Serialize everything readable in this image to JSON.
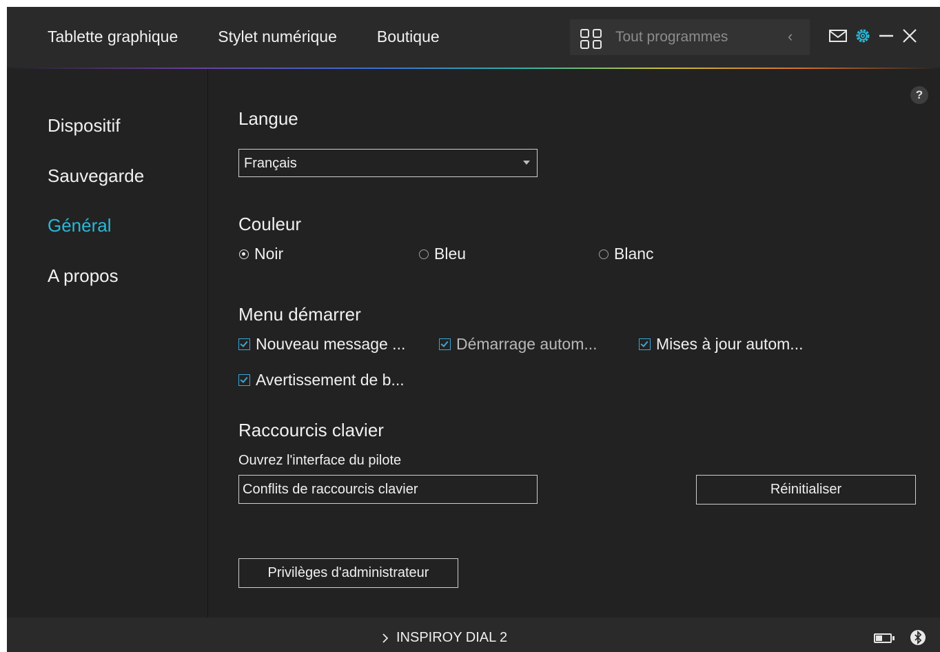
{
  "header": {
    "tabs": [
      {
        "label": "Tablette graphique"
      },
      {
        "label": "Stylet numérique"
      },
      {
        "label": "Boutique"
      }
    ],
    "search": {
      "placeholder": "Tout programmes",
      "grid_icon": "grid-icon",
      "back_icon": "chevron-left-icon"
    },
    "window_icons": [
      "mail-icon",
      "gear-icon",
      "minimize-icon",
      "close-icon"
    ],
    "accent_color": "#29b8d8"
  },
  "sidebar": {
    "items": [
      {
        "label": "Dispositif",
        "active": false
      },
      {
        "label": "Sauvegarde",
        "active": false
      },
      {
        "label": "Général",
        "active": true
      },
      {
        "label": "A propos",
        "active": false
      }
    ]
  },
  "main": {
    "help_label": "?",
    "language": {
      "title": "Langue",
      "selected": "Français"
    },
    "color": {
      "title": "Couleur",
      "options": [
        {
          "label": "Noir",
          "selected": true
        },
        {
          "label": "Bleu",
          "selected": false
        },
        {
          "label": "Blanc",
          "selected": false
        }
      ]
    },
    "startup_menu": {
      "title": "Menu démarrer",
      "options": [
        {
          "label": "Nouveau message ...",
          "checked": true
        },
        {
          "label": "Démarrage autom...",
          "checked": true
        },
        {
          "label": "Mises à jour autom...",
          "checked": true
        },
        {
          "label": "Avertissement de b...",
          "checked": true
        }
      ]
    },
    "shortcuts": {
      "title": "Raccourcis clavier",
      "field_label": "Ouvrez l'interface du pilote",
      "field_value": "Conflits de raccourcis clavier",
      "reset_label": "Réinitialiser"
    },
    "admin_label": "Privilèges d'administrateur"
  },
  "footer": {
    "device_name": "INSPIROY DIAL 2",
    "battery_level": 0.45,
    "battery_icon": "battery-icon",
    "bluetooth_icon": "bluetooth-icon"
  }
}
